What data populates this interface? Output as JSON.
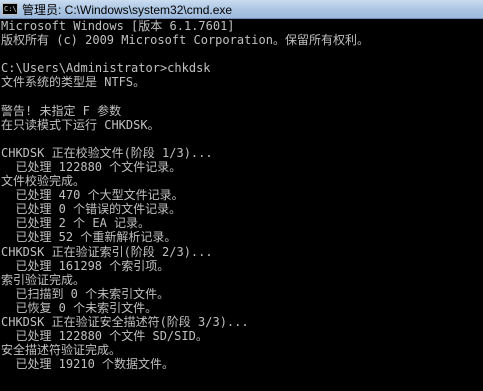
{
  "window": {
    "title": "管理员: C:\\Windows\\system32\\cmd.exe",
    "icon_label": "C:\\",
    "icon": "console-icon"
  },
  "colors": {
    "background": "#000000",
    "text": "#c0c0c0",
    "titlebar": "#a9c3e2"
  },
  "console": {
    "lines": [
      "Microsoft Windows [版本 6.1.7601]",
      "版权所有 (c) 2009 Microsoft Corporation。保留所有权利。",
      "",
      "C:\\Users\\Administrator>chkdsk",
      "文件系统的类型是 NTFS。",
      "",
      "警告! 未指定 F 参数",
      "在只读模式下运行 CHKDSK。",
      "",
      "CHKDSK 正在校验文件(阶段 1/3)...",
      "  已处理 122880 个文件记录。",
      "文件校验完成。",
      "  已处理 470 个大型文件记录。",
      "  已处理 0 个错误的文件记录。",
      "  已处理 2 个 EA 记录。",
      "  已处理 52 个重新解析记录。",
      "CHKDSK 正在验证索引(阶段 2/3)...",
      "  已处理 161298 个索引项。",
      "索引验证完成。",
      "  已扫描到 0 个未索引文件。",
      "  已恢复 0 个未索引文件。",
      "CHKDSK 正在验证安全描述符(阶段 3/3)...",
      "  已处理 122880 个文件 SD/SID。",
      "安全描述符验证完成。",
      "  已处理 19210 个数据文件。"
    ]
  }
}
